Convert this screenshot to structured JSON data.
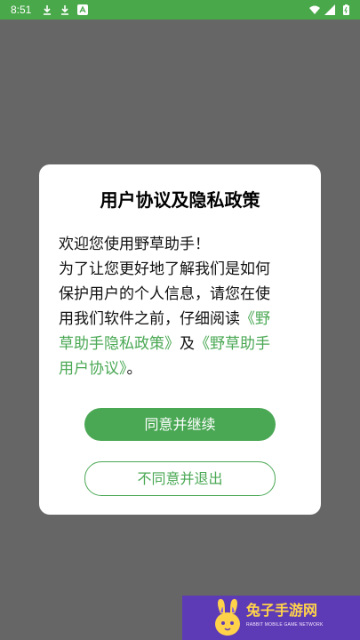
{
  "status_bar": {
    "time": "8:51",
    "icons": [
      "download-icon",
      "download-icon",
      "a-icon",
      "wifi-icon",
      "signal-icon",
      "battery-icon"
    ]
  },
  "dialog": {
    "title": "用户协议及隐私政策",
    "body_lines": [
      "欢迎您使用野草助手！",
      "为了让您更好地了解我们是如何",
      "保护用户的个人信息，请您在使",
      "用我们软件之前，仔细阅读"
    ],
    "privacy_link_part1": "《野",
    "privacy_link_part2": "草助手隐私政策》",
    "and_text": "及",
    "agreement_link_part1": "《野草助手",
    "agreement_link_part2": "用户协议》",
    "end_text": "。",
    "agree_label": "同意并继续",
    "disagree_label": "不同意并退出"
  },
  "watermark": {
    "title": "兔子手游网",
    "subtitle": "RABBIT MOBILE GAME NETWORK"
  },
  "colors": {
    "accent": "#4aa854",
    "status_bar": "#49a84a",
    "overlay": "#666666",
    "watermark_bg": "#5e3bb6"
  }
}
